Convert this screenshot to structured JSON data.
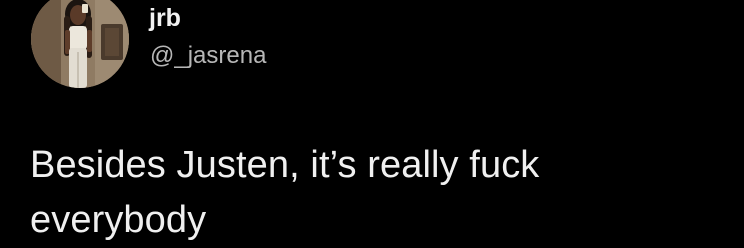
{
  "user": {
    "display_name": "jrb",
    "handle": "@_jasrena",
    "avatar_icon": "profile-photo"
  },
  "tweet": {
    "text": "Besides Justen, it’s really fuck everybody"
  },
  "colors": {
    "background": "#000000",
    "primary_text": "#f0f0f0",
    "secondary_text": "#b7b7b7"
  }
}
